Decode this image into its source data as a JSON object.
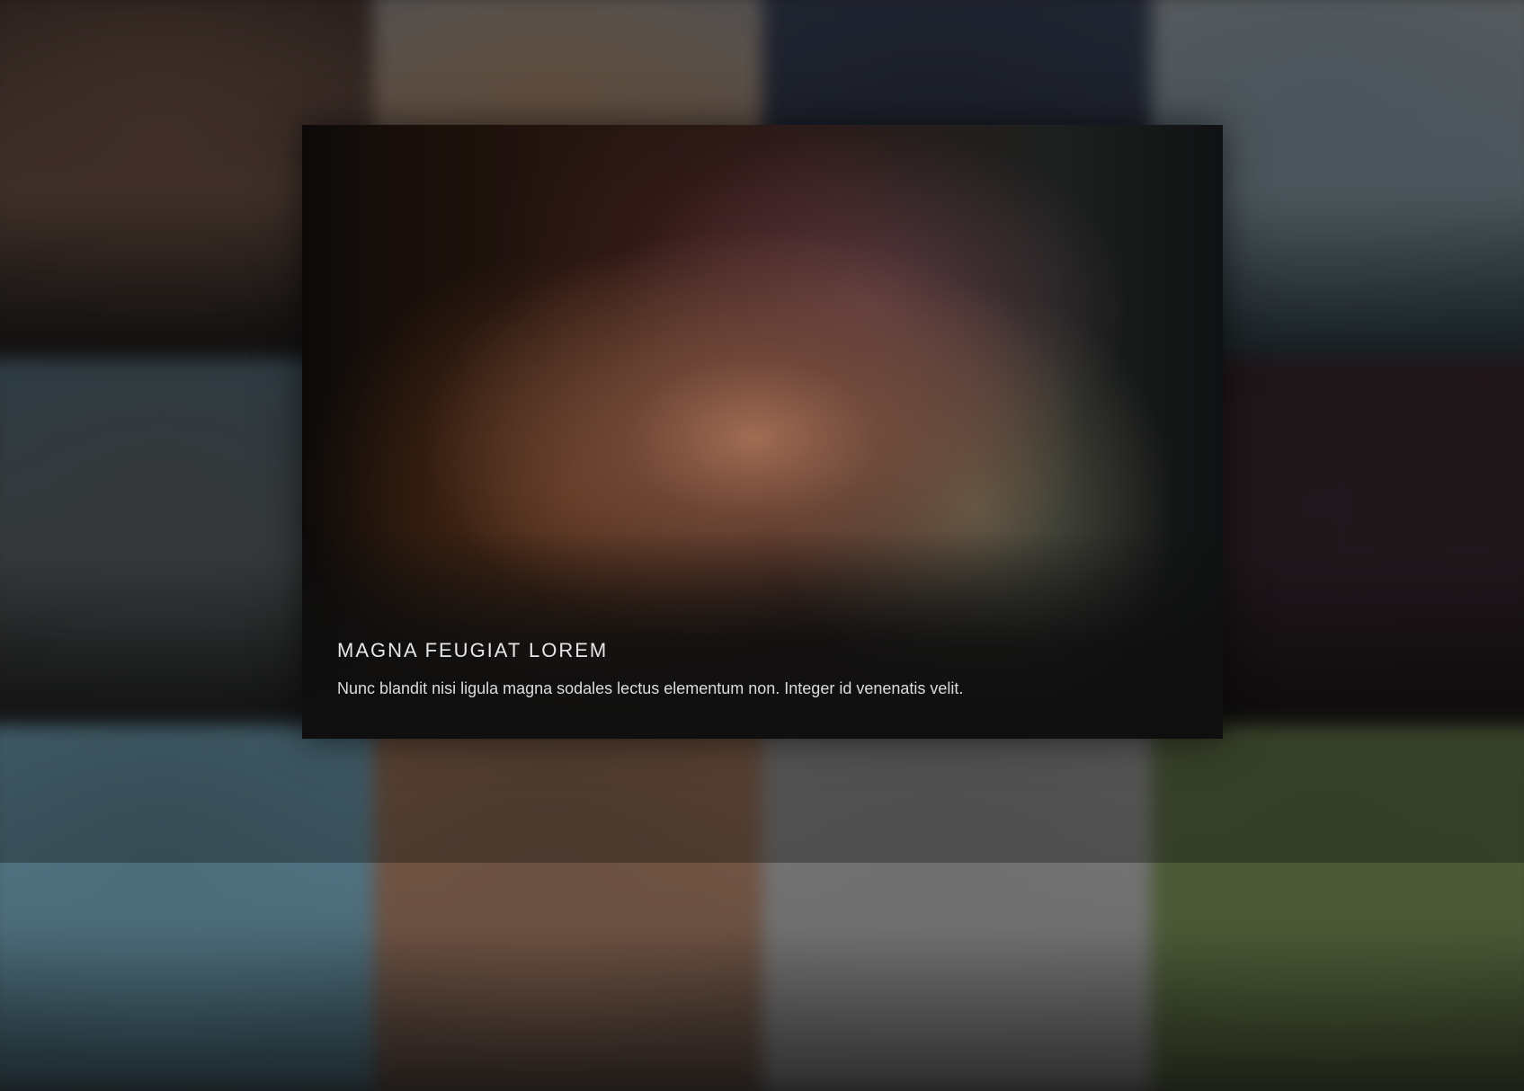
{
  "gallery": {
    "tiles": [
      {
        "caption": "",
        "colors": [
          "#3b2c28",
          "#5a4238",
          "#2f2a28"
        ]
      },
      {
        "caption": "",
        "colors": [
          "#777372",
          "#8a6e58",
          "#6b5f58"
        ]
      },
      {
        "caption": "",
        "colors": [
          "#2d3447",
          "#262b3a",
          "#1f2230"
        ]
      },
      {
        "caption": "",
        "colors": [
          "#7b8186",
          "#6a7a83",
          "#425c66"
        ]
      },
      {
        "caption": "",
        "colors": [
          "#3f5562",
          "#4a4f51",
          "#323436"
        ]
      },
      {
        "caption": "",
        "colors": [
          "#3a2c29",
          "#3d2a24",
          "#2a2524"
        ]
      },
      {
        "caption": "",
        "colors": [
          "#2d2b2f",
          "#2a2528",
          "#262226"
        ]
      },
      {
        "caption": "",
        "colors": [
          "#2b1c22",
          "#2a1e24",
          "#261d22"
        ]
      },
      {
        "caption": "",
        "colors": [
          "#5a8193",
          "#4c6c79",
          "#3c5561"
        ]
      },
      {
        "caption": "",
        "colors": [
          "#7f5c47",
          "#6b5142",
          "#4a3c36"
        ]
      },
      {
        "caption": "",
        "colors": [
          "#7b7b7b",
          "#707070",
          "#666666"
        ]
      },
      {
        "caption": "",
        "colors": [
          "#4e5d3a",
          "#4b5936",
          "#3f4b30"
        ]
      }
    ]
  },
  "lightbox": {
    "title": "MAGNA FEUGIAT LOREM",
    "description": "Nunc blandit nisi ligula magna sodales lectus elementum non. Integer id venenatis velit."
  }
}
